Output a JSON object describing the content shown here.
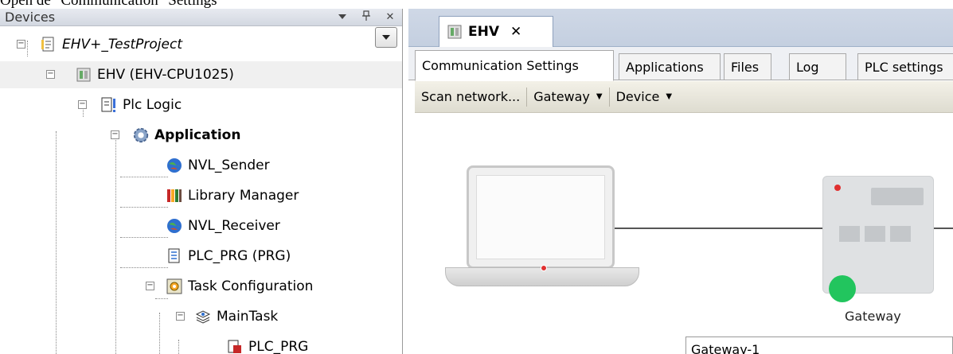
{
  "heading": "Open de \"Communication\" Settings",
  "devices_panel": {
    "title": "Devices",
    "pin_glyph": "ᵽ",
    "close_glyph": "✕",
    "tree": [
      {
        "label": "EHV+_TestProject",
        "icon": "project-icon"
      },
      {
        "label": "EHV (EHV-CPU1025)",
        "icon": "plc-device-icon"
      },
      {
        "label": "Plc Logic",
        "icon": "plc-logic-icon"
      },
      {
        "label": "Application",
        "icon": "application-gear-icon"
      },
      {
        "label": "NVL_Sender",
        "icon": "network-variable-list-icon"
      },
      {
        "label": "Library Manager",
        "icon": "library-manager-icon"
      },
      {
        "label": "NVL_Receiver",
        "icon": "network-variable-list-icon"
      },
      {
        "label": "PLC_PRG (PRG)",
        "icon": "program-document-icon"
      },
      {
        "label": "Task Configuration",
        "icon": "task-configuration-icon"
      },
      {
        "label": "MainTask",
        "icon": "main-task-icon"
      },
      {
        "label": "PLC_PRG",
        "icon": "program-call-icon"
      }
    ]
  },
  "editor": {
    "doc_tab": {
      "label": "EHV",
      "close_glyph": "✕"
    },
    "sub_tabs": [
      "Communication Settings",
      "Applications",
      "Files",
      "Log",
      "PLC settings"
    ],
    "toolbar": {
      "scan": "Scan network...",
      "gateway": "Gateway",
      "device": "Device"
    },
    "gateway_label": "Gateway",
    "gateway_field_value": "Gateway-1"
  },
  "colors": {
    "status_green": "#22c55e",
    "indicator_red": "#e03030"
  }
}
